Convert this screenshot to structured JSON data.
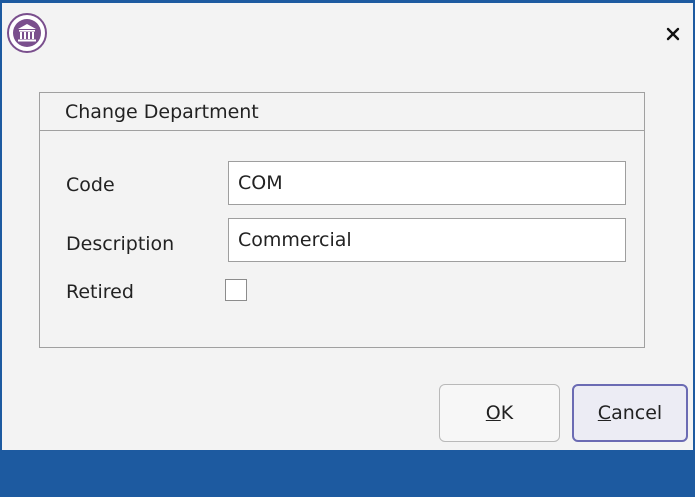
{
  "window": {
    "close_label": "×"
  },
  "group": {
    "title": "Change Department"
  },
  "form": {
    "code_label": "Code",
    "code_value": "COM",
    "description_label": "Description",
    "description_value": "Commercial",
    "retired_label": "Retired",
    "retired_checked": false
  },
  "buttons": {
    "ok_accel": "O",
    "ok_rest": "K",
    "cancel_accel": "C",
    "cancel_rest": "ancel"
  },
  "colors": {
    "titlebar_bottom": "#1d5aa0",
    "dialog_bg": "#f3f3f3",
    "icon_accent": "#7a4f8d",
    "focus_border": "#6b6bb3"
  },
  "icons": {
    "app": "institution-icon",
    "close": "close-icon"
  }
}
